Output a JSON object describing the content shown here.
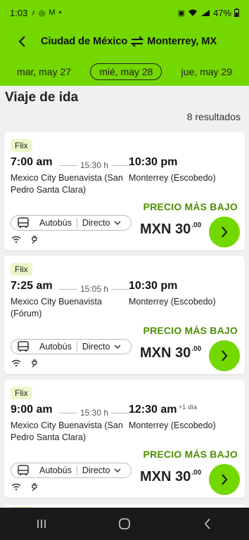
{
  "status_bar": {
    "time": "1:03",
    "battery": "47%"
  },
  "header": {
    "back_label": "‹",
    "origin": "Ciudad de México",
    "destination": "Monterrey, MX"
  },
  "dates": [
    {
      "label": "mar, may 27",
      "active": false
    },
    {
      "label": "mié, may 28",
      "active": true
    },
    {
      "label": "jue, may 29",
      "active": false
    }
  ],
  "section": {
    "title": "Viaje de ida",
    "results": "8 resultados"
  },
  "trips": [
    {
      "brand": "Flix",
      "departure_time": "7:00 am",
      "duration": "15:30 h",
      "arrival_time": "10:30 pm",
      "plus_day": "",
      "departure_station": "Mexico City Buenavista (San Pedro Santa Clara)",
      "arrival_station": "Monterrey (Escobedo)",
      "price_label": "PRECIO MÁS BAJO",
      "vehicle": "Autobús",
      "route_type": "Directo",
      "price_main": "MXN 30",
      "price_cents": ".00"
    },
    {
      "brand": "Flix",
      "departure_time": "7:25 am",
      "duration": "15:05 h",
      "arrival_time": "10:30 pm",
      "plus_day": "",
      "departure_station": "Mexico City Buenavista (Fórum)",
      "arrival_station": "Monterrey (Escobedo)",
      "price_label": "PRECIO MÁS BAJO",
      "vehicle": "Autobús",
      "route_type": "Directo",
      "price_main": "MXN 30",
      "price_cents": ".00"
    },
    {
      "brand": "Flix",
      "departure_time": "9:00 am",
      "duration": "15:30 h",
      "arrival_time": "12:30 am",
      "plus_day": "+1 día",
      "departure_station": "Mexico City Buenavista (San Pedro Santa Clara)",
      "arrival_station": "Monterrey (Escobedo)",
      "price_label": "PRECIO MÁS BAJO",
      "vehicle": "Autobús",
      "route_type": "Directo",
      "price_main": "MXN 30",
      "price_cents": ".00"
    }
  ],
  "colors": {
    "brand_green": "#73d700",
    "price_green": "#4d8f00"
  }
}
